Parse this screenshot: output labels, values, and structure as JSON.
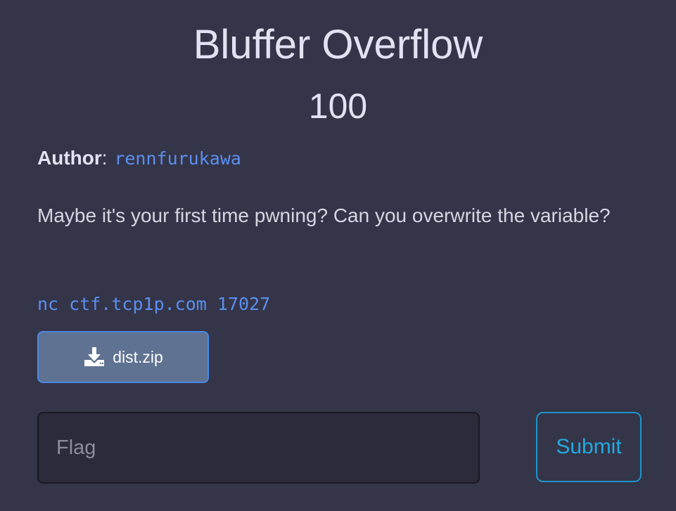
{
  "challenge": {
    "title": "Bluffer Overflow",
    "points": "100",
    "author_label": "Author",
    "author_separator": ": ",
    "author_name": "rennfurukawa",
    "description": "Maybe it's your first time pwning? Can you overwrite the variable?",
    "connection_command": "nc ctf.tcp1p.com 17027"
  },
  "attachment": {
    "label": "dist.zip",
    "icon": "download-icon"
  },
  "submission": {
    "flag_placeholder": "Flag",
    "flag_value": "",
    "submit_label": "Submit"
  },
  "colors": {
    "background": "#353549",
    "link": "#5b8ff0",
    "download_button": "#5f7291",
    "submit_accent": "#1d94c8"
  }
}
